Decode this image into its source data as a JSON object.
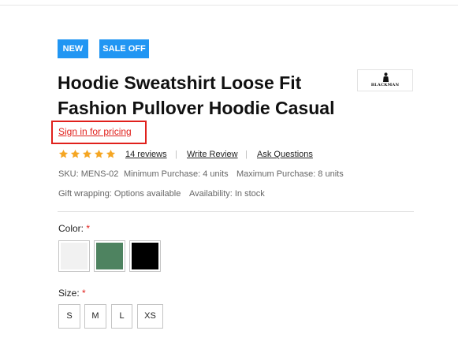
{
  "badges": {
    "new": "NEW",
    "sale": "SALE OFF",
    "color": "#2196f3"
  },
  "brand": {
    "logo_text": "BLACKMAN"
  },
  "product": {
    "title": "Hoodie Sweatshirt Loose Fit Fashion Pullover Hoodie Casual",
    "signin_text": "Sign in for pricing",
    "rating": 5,
    "reviews_link": "14 reviews",
    "write_review_link": "Write Review",
    "ask_link": "Ask Questions",
    "separator": "|",
    "sku": "SKU: MENS-02",
    "min_purchase": "Minimum Purchase: 4 units",
    "max_purchase": "Maximum Purchase: 8 units",
    "gift_wrapping": "Gift wrapping: Options available",
    "availability": "Availability: In stock"
  },
  "options": {
    "color": {
      "label": "Color:",
      "required_mark": "*",
      "swatches": [
        {
          "name": "White",
          "hex": "#f1f1f1"
        },
        {
          "name": "Green",
          "hex": "#4e8360"
        },
        {
          "name": "Black",
          "hex": "#000000"
        }
      ]
    },
    "size": {
      "label": "Size:",
      "required_mark": "*",
      "values": [
        "S",
        "M",
        "L",
        "XS"
      ]
    }
  },
  "colors": {
    "accent_red": "#e0201c",
    "star": "#f5a623"
  }
}
